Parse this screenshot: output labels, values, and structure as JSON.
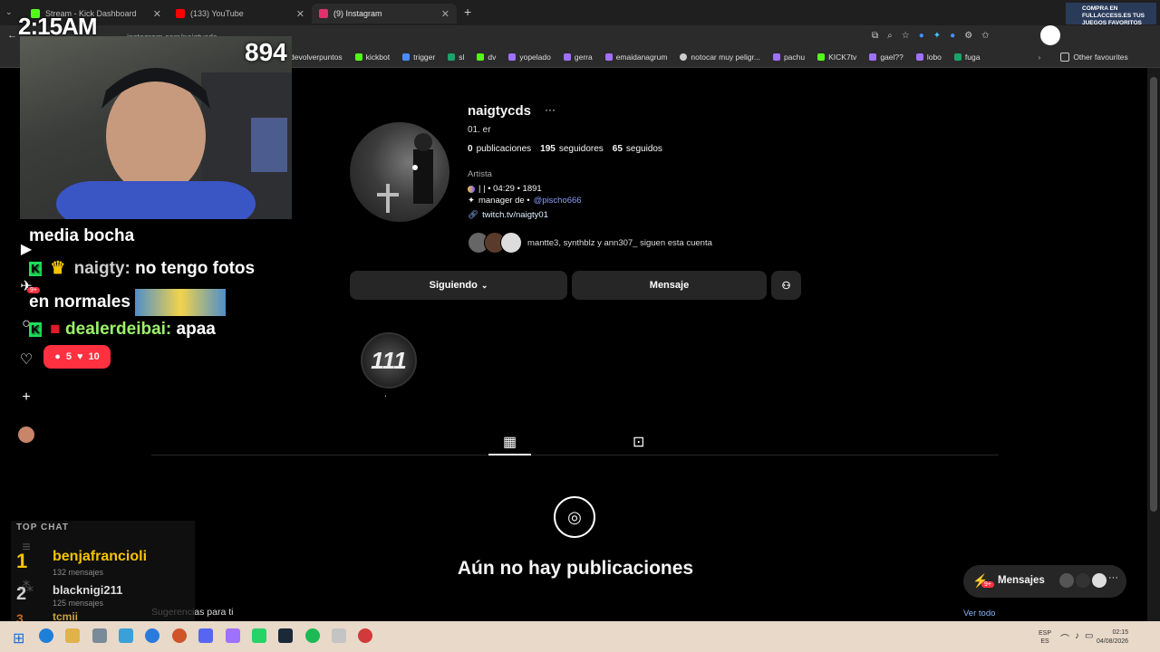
{
  "browser": {
    "tabs": [
      {
        "title": "Stream - Kick Dashboard",
        "color": "#53fc18"
      },
      {
        "title": "(133) YouTube",
        "color": "#ff0000"
      },
      {
        "title": "(9) Instagram",
        "color": "#e1306c"
      }
    ],
    "url": "instagram.com/naigtycds",
    "bookmarks": [
      "devolverpuntos",
      "kickbot",
      "trigger",
      "sl",
      "dv",
      "yopelado",
      "gerra",
      "emaidanagrum",
      "notocar muy peligr...",
      "pachu",
      "KICK7tv",
      "gael??",
      "lobo",
      "fuga"
    ],
    "other_favourites": "Other favourites"
  },
  "stream_overlay": {
    "clock": "2:15AM",
    "viewers": "894",
    "chat": [
      {
        "user": "",
        "text": "media bocha"
      },
      {
        "user": "naigty:",
        "text": "no tengo fotos"
      },
      {
        "user": "",
        "text": "en normales"
      },
      {
        "user": "dealerdeibai:",
        "text": "apaa"
      }
    ],
    "top_chat_title": "TOP CHAT",
    "top_chat": [
      {
        "rank": "1",
        "name": "benjafrancioli",
        "count": "132 mensajes"
      },
      {
        "rank": "2",
        "name": "blacknigi211",
        "count": "125 mensajes"
      },
      {
        "rank": "3",
        "name": "tcmii",
        "count": ""
      }
    ],
    "promo": "COMPRA EN FULLACCESS.ES TUS JUEGOS FAVORITOS"
  },
  "profile": {
    "username": "naigtycds",
    "more": "···",
    "name_line": "01.  er",
    "posts_count": "0",
    "posts_label": "publicaciones",
    "followers_count": "195",
    "followers_label": "seguidores",
    "following_count": "65",
    "following_label": "seguidos",
    "category": "Artista",
    "bio_line1": "| | • 04:29 • 1891",
    "bio_line2": "manager de •",
    "bio_mention": "@pischo666",
    "link": "twitch.tv/naigty01",
    "followed_by": "mantte3, synthblz y ann307_ siguen esta cuenta",
    "btn_following": "Siguiendo",
    "btn_message": "Mensaje",
    "highlight_label": "111",
    "highlight_caption": ".",
    "empty_title": "Aún no hay publicaciones",
    "suggestions": "Sugerencias para ti",
    "see_all": "Ver todo",
    "messages_label": "Mensajes",
    "notif_badge": "9+",
    "reaction_comments": "5",
    "reaction_likes": "10"
  },
  "taskbar": {
    "lang": "ESP",
    "lang2": "ES",
    "time": "02:15",
    "date": "04/08/2026"
  }
}
